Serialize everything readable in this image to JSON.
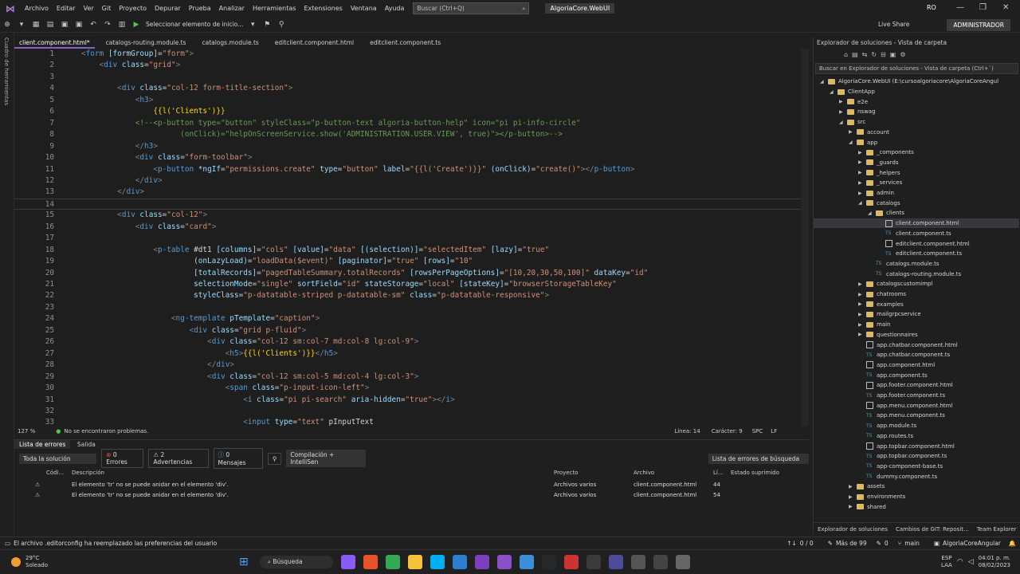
{
  "menu": {
    "items": [
      "Archivo",
      "Editar",
      "Ver",
      "Git",
      "Proyecto",
      "Depurar",
      "Prueba",
      "Analizar",
      "Herramientas",
      "Extensiones",
      "Ventana",
      "Ayuda"
    ],
    "search_placeholder": "Buscar (Ctrl+Q)",
    "solution_badge": "AlgoriaCore.WebUI",
    "user_initials": "RO"
  },
  "toolbar": {
    "run_label": "Seleccionar elemento de inicio...",
    "live_share": "Live Share",
    "admin_label": "ADMINISTRADOR"
  },
  "left_strip_label": "Cuadro de herramientas",
  "tabs": [
    {
      "label": "client.component.html*",
      "active": true
    },
    {
      "label": "catalogs-routing.module.ts",
      "active": false
    },
    {
      "label": "catalogs.module.ts",
      "active": false
    },
    {
      "label": "editclient.component.html",
      "active": false
    },
    {
      "label": "editclient.component.ts",
      "active": false
    }
  ],
  "code_line_numbers": [
    "1",
    "2",
    "3",
    "4",
    "5",
    "6",
    "7",
    "8",
    "9",
    "10",
    "11",
    "12",
    "13",
    "14",
    "15",
    "16",
    "17",
    "18",
    "19",
    "20",
    "21",
    "22",
    "23",
    "24",
    "25",
    "26",
    "27",
    "28",
    "29",
    "30",
    "31",
    "32",
    "33"
  ],
  "code_lines": [
    "<form [formGroup]=\"form\">",
    "    <div class=\"grid\">",
    "",
    "        <div class=\"col-12 form-title-section\">",
    "            <h3>",
    "                {{l('Clients')}}",
    "            <!--<p-button type=\"button\" styleClass=\"p-button-text algoria-button-help\" icon=\"pi pi-info-circle\"",
    "                      (onClick)=\"helpOnScreenService.show('ADMINISTRATION.USER.VIEW', true)\"></p-button>-->",
    "            </h3>",
    "            <div class=\"form-toolbar\">",
    "                <p-button *ngIf=\"permissions.create\" type=\"button\" label=\"{{l('Create')}}\" (onClick)=\"create()\"></p-button>",
    "            </div>",
    "        </div>",
    "",
    "        <div class=\"col-12\">",
    "            <div class=\"card\">",
    "",
    "                <p-table #dt1 [columns]=\"cols\" [value]=\"data\" [(selection)]=\"selectedItem\" [lazy]=\"true\"",
    "                         (onLazyLoad)=\"loadData($event)\" [paginator]=\"true\" [rows]=\"10\"",
    "                         [totalRecords]=\"pagedTableSummary.totalRecords\" [rowsPerPageOptions]=\"[10,20,30,50,100]\" dataKey=\"id\"",
    "                         selectionMode=\"single\" sortField=\"id\" stateStorage=\"local\" [stateKey]=\"browserStorageTableKey\"",
    "                         styleClass=\"p-datatable-striped p-datatable-sm\" class=\"p-datatable-responsive\">",
    "",
    "                    <ng-template pTemplate=\"caption\">",
    "                        <div class=\"grid p-fluid\">",
    "                            <div class=\"col-12 sm:col-7 md:col-8 lg:col-9\">",
    "                                <h5>{{l('Clients')}}</h5>",
    "                            </div>",
    "                            <div class=\"col-12 sm:col-5 md:col-4 lg:col-3\">",
    "                                <span class=\"p-input-icon-left\">",
    "                                    <i class=\"pi pi-search\" aria-hidden=\"true\"></i>",
    "",
    "                                    <input type=\"text\" pInputText"
  ],
  "editor_status": {
    "zoom": "127 %",
    "problems": "No se encontraron problemas.",
    "line": "Línea: 14",
    "char": "Carácter: 9",
    "spc": "SPC",
    "lf": "LF"
  },
  "errors_panel": {
    "tab_errors": "Lista de errores",
    "tab_output": "Salida",
    "scope": "Toda la solución",
    "errors": "0 Errores",
    "warnings": "2 Advertencias",
    "messages": "0 Mensajes",
    "build": "Compilación + IntelliSen",
    "search": "Lista de errores de búsqueda",
    "headers": {
      "code": "Códi...",
      "desc": "Descripción",
      "project": "Proyecto",
      "file": "Archivo",
      "line": "Lí...",
      "state": "Estado suprimido"
    },
    "rows": [
      {
        "desc": "El elemento 'tr' no se puede anidar en el elemento 'div'.",
        "project": "Archivos varios",
        "file": "client.component.html",
        "line": "44"
      },
      {
        "desc": "El elemento 'tr' no se puede anidar en el elemento 'div'.",
        "project": "Archivos varios",
        "file": "client.component.html",
        "line": "54"
      }
    ]
  },
  "solution_explorer": {
    "title": "Explorador de soluciones - Vista de carpeta",
    "search": "Buscar en Explorador de soluciones - Vista de carpeta (Ctrl+`)",
    "tree": [
      {
        "label": "AlgoriaCore.WebUI (E:\\cursoalgoriacore\\AlgoriaCoreAngul",
        "indent": 0,
        "type": "root",
        "arrow": "◢"
      },
      {
        "label": "ClientApp",
        "indent": 1,
        "type": "folder",
        "arrow": "◢"
      },
      {
        "label": "e2e",
        "indent": 2,
        "type": "folder",
        "arrow": "▶"
      },
      {
        "label": "nswag",
        "indent": 2,
        "type": "folder",
        "arrow": "▶"
      },
      {
        "label": "src",
        "indent": 2,
        "type": "folder",
        "arrow": "◢"
      },
      {
        "label": "account",
        "indent": 3,
        "type": "folder",
        "arrow": "▶"
      },
      {
        "label": "app",
        "indent": 3,
        "type": "folder",
        "arrow": "◢"
      },
      {
        "label": "_components",
        "indent": 4,
        "type": "folder",
        "arrow": "▶"
      },
      {
        "label": "_guards",
        "indent": 4,
        "type": "folder",
        "arrow": "▶"
      },
      {
        "label": "_helpers",
        "indent": 4,
        "type": "folder",
        "arrow": "▶"
      },
      {
        "label": "_services",
        "indent": 4,
        "type": "folder",
        "arrow": "▶"
      },
      {
        "label": "admin",
        "indent": 4,
        "type": "folder",
        "arrow": "▶"
      },
      {
        "label": "catalogs",
        "indent": 4,
        "type": "folder",
        "arrow": "◢"
      },
      {
        "label": "clients",
        "indent": 5,
        "type": "folder",
        "arrow": "◢"
      },
      {
        "label": "client.component.html",
        "indent": 6,
        "type": "html",
        "arrow": "",
        "selected": true
      },
      {
        "label": "client.component.ts",
        "indent": 6,
        "type": "ts",
        "arrow": ""
      },
      {
        "label": "editclient.component.html",
        "indent": 6,
        "type": "html",
        "arrow": ""
      },
      {
        "label": "editclient.component.ts",
        "indent": 6,
        "type": "ts",
        "arrow": ""
      },
      {
        "label": "catalogs.module.ts",
        "indent": 5,
        "type": "ts",
        "arrow": ""
      },
      {
        "label": "catalogs-routing.module.ts",
        "indent": 5,
        "type": "ts",
        "arrow": ""
      },
      {
        "label": "catalogscustomimpl",
        "indent": 4,
        "type": "folder",
        "arrow": "▶"
      },
      {
        "label": "chatrooms",
        "indent": 4,
        "type": "folder",
        "arrow": "▶"
      },
      {
        "label": "examples",
        "indent": 4,
        "type": "folder",
        "arrow": "▶"
      },
      {
        "label": "mailgrpcservice",
        "indent": 4,
        "type": "folder",
        "arrow": "▶"
      },
      {
        "label": "main",
        "indent": 4,
        "type": "folder",
        "arrow": "▶"
      },
      {
        "label": "questionnaires",
        "indent": 4,
        "type": "folder",
        "arrow": "▶"
      },
      {
        "label": "app.chatbar.component.html",
        "indent": 4,
        "type": "html",
        "arrow": ""
      },
      {
        "label": "app.chatbar.component.ts",
        "indent": 4,
        "type": "ts",
        "arrow": ""
      },
      {
        "label": "app.component.html",
        "indent": 4,
        "type": "html",
        "arrow": ""
      },
      {
        "label": "app.component.ts",
        "indent": 4,
        "type": "ts",
        "arrow": ""
      },
      {
        "label": "app.footer.component.html",
        "indent": 4,
        "type": "html",
        "arrow": ""
      },
      {
        "label": "app.footer.component.ts",
        "indent": 4,
        "type": "ts",
        "arrow": ""
      },
      {
        "label": "app.menu.component.html",
        "indent": 4,
        "type": "html",
        "arrow": ""
      },
      {
        "label": "app.menu.component.ts",
        "indent": 4,
        "type": "ts",
        "arrow": ""
      },
      {
        "label": "app.module.ts",
        "indent": 4,
        "type": "ts",
        "arrow": ""
      },
      {
        "label": "app.routes.ts",
        "indent": 4,
        "type": "ts",
        "arrow": ""
      },
      {
        "label": "app.topbar.component.html",
        "indent": 4,
        "type": "html",
        "arrow": ""
      },
      {
        "label": "app.topbar.component.ts",
        "indent": 4,
        "type": "ts",
        "arrow": ""
      },
      {
        "label": "app-component-base.ts",
        "indent": 4,
        "type": "ts",
        "arrow": ""
      },
      {
        "label": "dummy.component.ts",
        "indent": 4,
        "type": "ts",
        "arrow": ""
      },
      {
        "label": "assets",
        "indent": 3,
        "type": "folder",
        "arrow": "▶"
      },
      {
        "label": "environments",
        "indent": 3,
        "type": "folder",
        "arrow": "▶"
      },
      {
        "label": "shared",
        "indent": 3,
        "type": "folder",
        "arrow": "▶"
      }
    ],
    "bottom_tabs": [
      "Explorador de soluciones",
      "Cambios de GIT: Reposit...",
      "Team Explorer"
    ]
  },
  "statusbar": {
    "message": "El archivo .editorconfig ha reemplazado las preferencias del usuario",
    "counter": "0 / 0",
    "more": "Más de 99",
    "zero": "0",
    "branch": "main",
    "project": "AlgoriaCoreAngular"
  },
  "taskbar": {
    "weather_temp": "29°C",
    "weather_desc": "Soleado",
    "search": "Búsqueda",
    "lang": "ESP",
    "lang2": "LAA",
    "time": "04:01 p. m.",
    "date": "08/02/2023"
  }
}
